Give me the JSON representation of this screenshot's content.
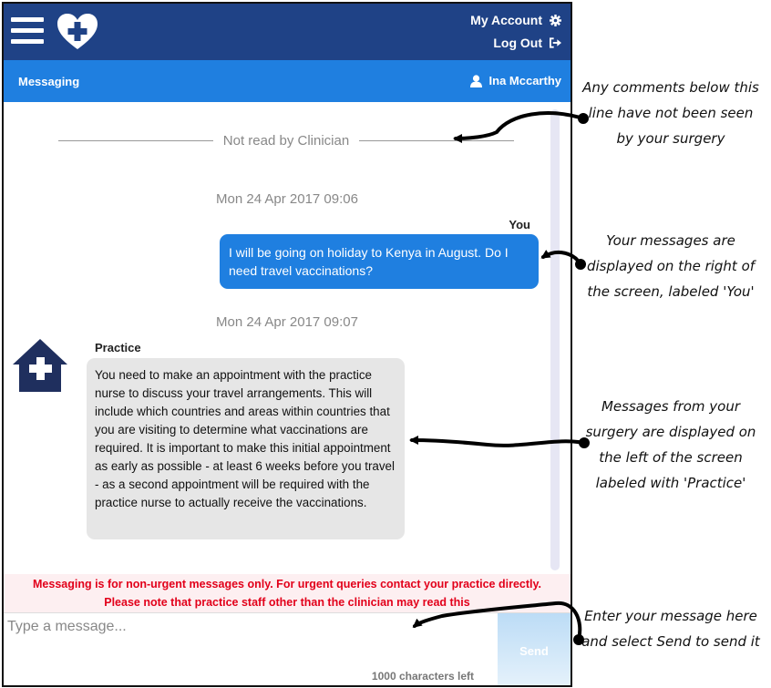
{
  "header": {
    "account_label": "My Account",
    "logout_label": "Log Out"
  },
  "subheader": {
    "title": "Messaging",
    "user_name": "Ina Mccarthy"
  },
  "conversation": {
    "unread_divider": "Not read by Clinician",
    "messages": [
      {
        "date": "Mon 24 Apr 2017 09:06",
        "sender": "You",
        "text": "I will be going on holiday to Kenya in August. Do I need travel vaccinations?"
      },
      {
        "date": "Mon 24 Apr 2017 09:07",
        "sender": "Practice",
        "text": "You need to make an appointment with the practice nurse to discuss your travel arrangements. This will include which countries and areas within countries that you are visiting to determine what vaccinations are required. It is important to make this initial appointment as early as possible - at least 6 weeks before you travel - as a second appointment will be required with the practice nurse to actually receive the vaccinations."
      }
    ]
  },
  "warning": {
    "line1": "Messaging is for non-urgent messages only. For urgent queries contact your practice directly.",
    "line2": "Please note that practice staff other than the clinician may read this"
  },
  "composer": {
    "placeholder": "Type a message...",
    "chars_left": "1000 characters left",
    "send_label": "Send"
  },
  "annotations": {
    "unread": "Any comments below this line have not been seen by your surgery",
    "yours": "Your messages are displayed on the right of the screen, labeled 'You'",
    "practice": "Messages from your surgery are displayed on the left of the screen labeled with 'Practice'",
    "compose": "Enter your message here and select Send to send it"
  },
  "icons": {
    "menu": "hamburger-menu-icon",
    "logo": "heart-cross-logo",
    "account": "gear-icon",
    "logout": "logout-icon",
    "user": "user-icon",
    "practice": "house-cross-icon"
  },
  "colors": {
    "header_dark": "#1f4286",
    "header_accent": "#1f7fe0",
    "practice_bubble": "#e6e6e6",
    "warning_text": "#e2001a"
  }
}
